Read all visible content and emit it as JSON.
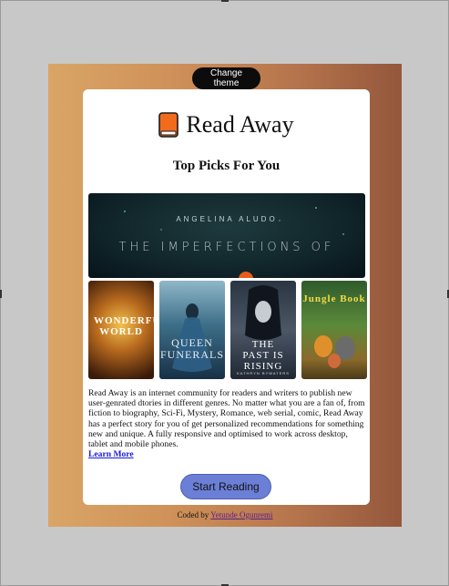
{
  "controls": {
    "change_theme_label": "Change theme"
  },
  "brand": {
    "name": "Read Away",
    "icon": "book-icon"
  },
  "section": {
    "title": "Top Picks For You"
  },
  "hero_book": {
    "author": "ANGELINA ALUDO",
    "title": "THE IMPERFECTIONS OF"
  },
  "covers": [
    {
      "title": "WONDERFUL WORLD",
      "author": ""
    },
    {
      "title": "QUEEN FUNERALS",
      "author": ""
    },
    {
      "title": "THE PAST IS RISING",
      "author": "KATHRYN BYWATERS"
    },
    {
      "title": "Jungle Book",
      "author": ""
    }
  ],
  "description": {
    "text": "Read Away is an internet community for readers and writers to publish new user-genrated dtories in different genres. No matter what you are a fan of, from fiction to biography, Sci-Fi, Mystery, Romance, web serial, comic, Read Away has a perfect story for you of get personalized recommendations for something new and unique. A fully responsive and optimised to work across desktop, tablet and mobile phones.",
    "learn_more_label": "Learn More"
  },
  "cta": {
    "start_reading_label": "Start Reading"
  },
  "footer": {
    "prefix": "Coded by",
    "author_name": "Yetunde Ogunremi"
  },
  "colors": {
    "page_background": "#c8c8c8",
    "gradient_start": "#d9a566",
    "gradient_end": "#94573c",
    "brand_icon": "#f26b1d",
    "start_button": "#6b7fd7",
    "link": "#1a1adb"
  }
}
